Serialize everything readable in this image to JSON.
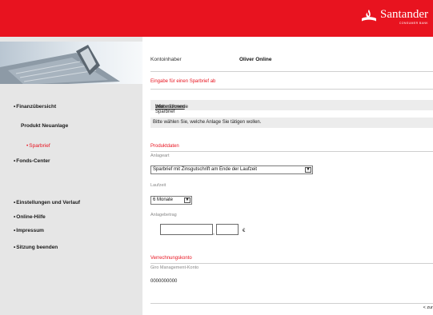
{
  "brand": {
    "name": "Santander",
    "subtitle": "CONSUMER BANK",
    "color": "#e8131f"
  },
  "sidebar": {
    "items": [
      {
        "label": "Finanzübersicht",
        "bullet": "•"
      },
      {
        "label": "Produkt Neuanlage",
        "bullet": ""
      },
      {
        "label": "Sparbrief",
        "bullet": "•",
        "active": true
      },
      {
        "label": "Fonds-Center",
        "bullet": "•"
      },
      {
        "label": "Einstellungen und Verlauf",
        "bullet": "•"
      },
      {
        "label": "Online-Hilfe",
        "bullet": "•"
      },
      {
        "label": "Impressum",
        "bullet": "•"
      },
      {
        "label": "Sitzung beenden",
        "bullet": "•"
      }
    ]
  },
  "main": {
    "contact_label": "Kontoinhaber",
    "contact_name": "Oliver Online",
    "section_title": "Eingabe für einen Sparbrief ab",
    "info_prefix": "Weiterführende ",
    "info_link": "Informationen",
    "info_suffix": " zum Sparbrief",
    "instruction": "Bitte wählen Sie, welche Anlage Sie tätigen wollen.",
    "product_section": "Produktdaten",
    "fields": {
      "anlageart_label": "Anlageart",
      "anlageart_value": "Sparbrief mit Zinsgutschrift am Ende der Laufzeit",
      "laufzeit_label": "Laufzeit",
      "laufzeit_value": "6 Monate",
      "betrag_label": "Anlagebetrag",
      "betrag_whole": "",
      "betrag_cents": "",
      "currency": "€"
    },
    "ref_section": "Verrechnungskonto",
    "ref_label": "Giro Management-Konto",
    "ref_value": "0000000000",
    "footer_link": "< zur"
  }
}
